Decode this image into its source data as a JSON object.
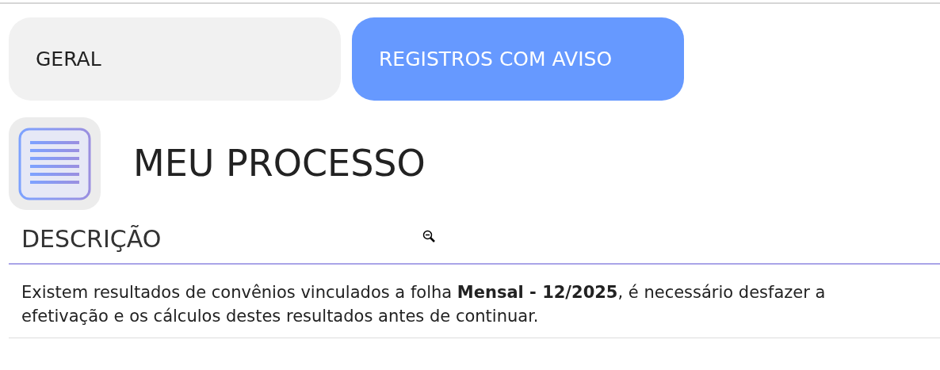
{
  "tabs": [
    {
      "label": "GERAL",
      "selected": false
    },
    {
      "label": "REGISTROS COM AVISO",
      "selected": true
    }
  ],
  "process": {
    "title": "MEU PROCESSO"
  },
  "section": {
    "heading": "DESCRIÇÃO",
    "message": "Existem resultados de convênios vinculados a folha **Mensal - 12/2025**, é necessário desfazer a efetivação e os cálculos destes resultados antes de continuar."
  }
}
